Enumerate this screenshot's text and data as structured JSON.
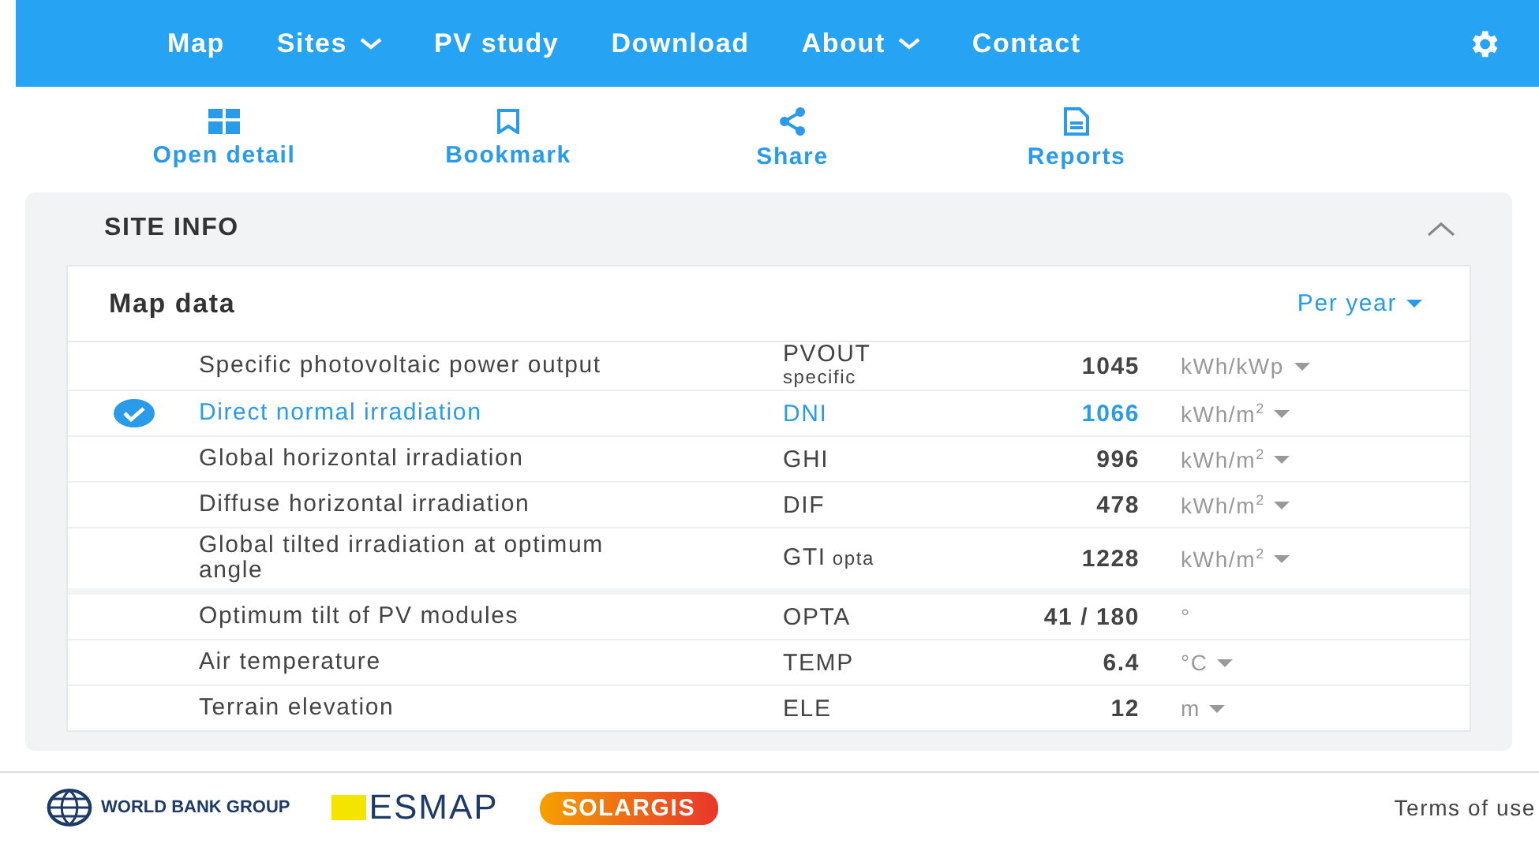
{
  "nav": {
    "items": [
      {
        "label": "Map",
        "dropdown": false
      },
      {
        "label": "Sites",
        "dropdown": true
      },
      {
        "label": "PV study",
        "dropdown": false
      },
      {
        "label": "Download",
        "dropdown": false
      },
      {
        "label": "About",
        "dropdown": true
      },
      {
        "label": "Contact",
        "dropdown": false
      }
    ]
  },
  "actions": [
    {
      "label": "Open detail",
      "kind": "grid"
    },
    {
      "label": "Bookmark",
      "kind": "bookmark"
    },
    {
      "label": "Share",
      "kind": "share"
    },
    {
      "label": "Reports",
      "kind": "report"
    }
  ],
  "site_info": {
    "title": "SITE INFO",
    "expanded": true,
    "map_data": {
      "title": "Map data",
      "period": "Per year",
      "groups": [
        [
          {
            "name": "Specific photovoltaic power output",
            "code": "PVOUT",
            "qualifier": "specific",
            "kind": "stacked",
            "value": "1045",
            "unit": "kWh/kWp",
            "unit_menu": true,
            "selected": false
          },
          {
            "name": "Direct normal irradiation",
            "code": "DNI",
            "value": "1066",
            "unit": "kWh/m$^{2}$",
            "unit_menu": true,
            "selected": true
          },
          {
            "name": "Global horizontal irradiation",
            "code": "GHI",
            "value": "996",
            "unit": "kWh/m$^{2}$",
            "unit_menu": true,
            "selected": false
          },
          {
            "name": "Diffuse horizontal irradiation",
            "code": "DIF",
            "value": "478",
            "unit": "kWh/m$^{2}$",
            "unit_menu": true,
            "selected": false
          },
          {
            "name": "Global tilted irradiation at optimum angle",
            "code": "GTI",
            "qualifier": "opta",
            "kind": "inline",
            "value": "1228",
            "unit": "kWh/m$^{2}$",
            "unit_menu": true,
            "selected": false
          }
        ],
        [
          {
            "name": "Optimum tilt of PV modules",
            "code": "OPTA",
            "value": "41 /  180",
            "unit": "°",
            "unit_menu": false,
            "selected": false
          },
          {
            "name": "Air temperature",
            "code": "TEMP",
            "value": "6.4",
            "unit": "°C",
            "unit_menu": true,
            "selected": false
          },
          {
            "name": "Terrain elevation",
            "code": "ELE",
            "value": "12",
            "unit": "m",
            "unit_menu": true,
            "selected": false
          }
        ]
      ]
    }
  },
  "footer": {
    "logos": [
      {
        "kind": "worldbank",
        "text": "WORLD BANK GROUP"
      },
      {
        "kind": "esmap",
        "text": "ESMAP"
      },
      {
        "kind": "solargis",
        "text": "SOLARGIS"
      }
    ],
    "link": "Terms of use"
  }
}
